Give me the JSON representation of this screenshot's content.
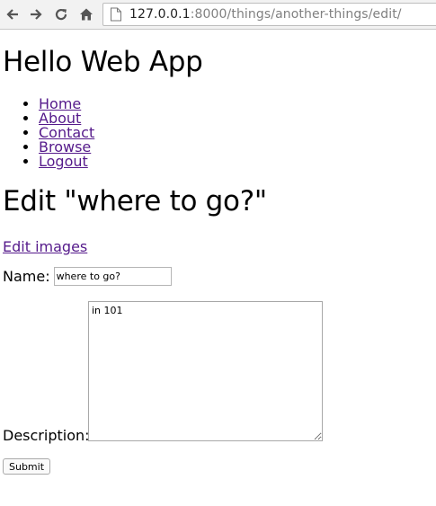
{
  "browser": {
    "url_host": "127.0.0.1",
    "url_path": ":8000/things/another-things/edit/",
    "icons": {
      "back": "back-arrow-icon",
      "forward": "forward-arrow-icon",
      "reload": "reload-icon",
      "home": "home-icon",
      "page": "page-icon"
    }
  },
  "page": {
    "site_title": "Hello Web App",
    "nav": [
      "Home",
      "About",
      "Contact",
      "Browse",
      "Logout"
    ],
    "edit_title": "Edit \"where to go?\"",
    "edit_images_link": "Edit images",
    "form": {
      "name_label": "Name:",
      "name_value": "where to go?",
      "description_label": "Description:",
      "description_value": "in 101",
      "submit_label": "Submit"
    }
  },
  "colors": {
    "link": "#551a8b",
    "toolbar_bg": "#f2f2f2"
  }
}
